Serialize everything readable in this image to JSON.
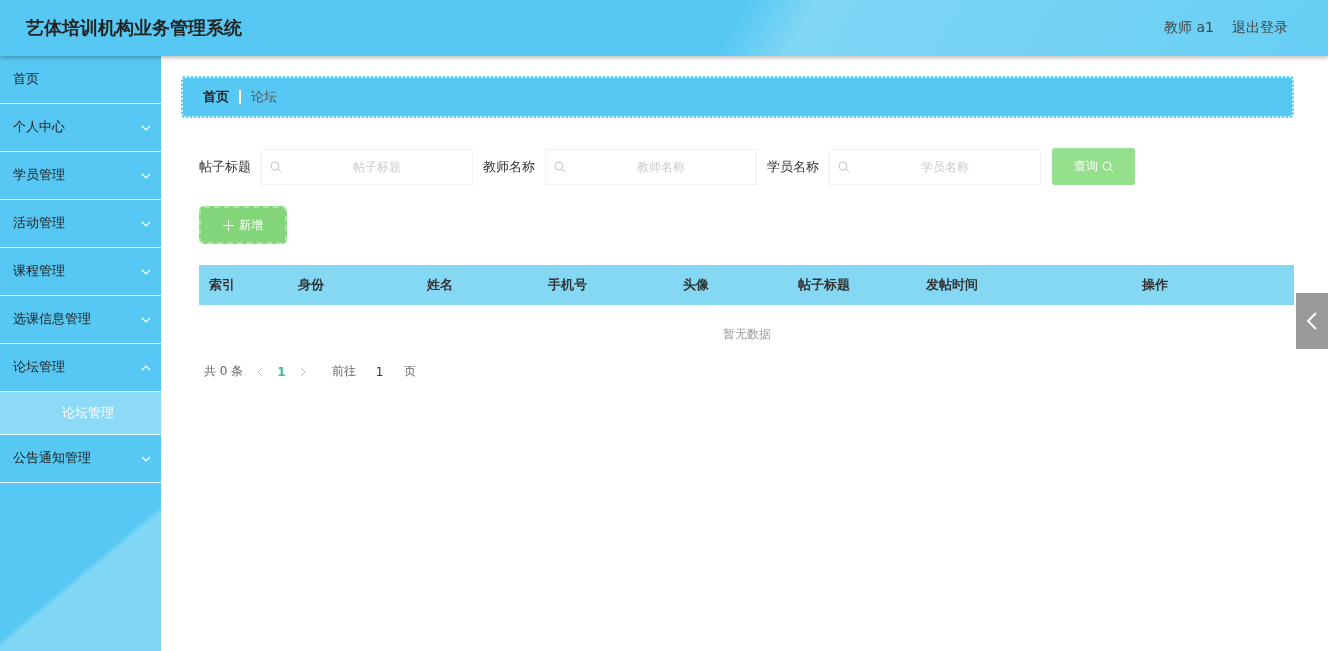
{
  "header": {
    "title": "艺体培训机构业务管理系统",
    "user": "教师 a1",
    "logout": "退出登录"
  },
  "sidebar": {
    "items": [
      {
        "label": "首页",
        "has_children": false
      },
      {
        "label": "个人中心",
        "has_children": true,
        "expanded": false
      },
      {
        "label": "学员管理",
        "has_children": true,
        "expanded": false
      },
      {
        "label": "活动管理",
        "has_children": true,
        "expanded": false
      },
      {
        "label": "课程管理",
        "has_children": true,
        "expanded": false
      },
      {
        "label": "选课信息管理",
        "has_children": true,
        "expanded": false
      },
      {
        "label": "论坛管理",
        "has_children": true,
        "expanded": true,
        "children": [
          {
            "label": "论坛管理",
            "selected": true
          }
        ]
      },
      {
        "label": "公告通知管理",
        "has_children": true,
        "expanded": false
      }
    ]
  },
  "breadcrumb": [
    "首页",
    "论坛"
  ],
  "filters": [
    {
      "label": "帖子标题",
      "placeholder": "帖子标题"
    },
    {
      "label": "教师名称",
      "placeholder": "教师名称"
    },
    {
      "label": "学员名称",
      "placeholder": "学员名称"
    }
  ],
  "search_button": "查询",
  "add_button": "新增",
  "table": {
    "columns": [
      "索引",
      "身份",
      "姓名",
      "手机号",
      "头像",
      "帖子标题",
      "发帖时间",
      "操作"
    ],
    "empty_text": "暂无数据"
  },
  "pagination": {
    "total": "共 0 条",
    "current_page": "1",
    "goto_label": "前往",
    "goto_value": "1",
    "page_suffix": "页"
  }
}
